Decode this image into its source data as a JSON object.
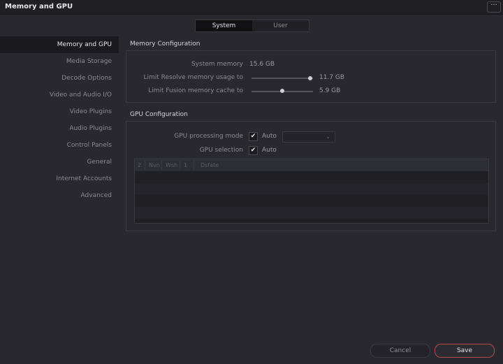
{
  "window": {
    "title": "Memory and GPU",
    "more_label": "···"
  },
  "tabs": [
    {
      "label": "System",
      "active": true
    },
    {
      "label": "User",
      "active": false
    }
  ],
  "sidebar": {
    "items": [
      {
        "label": "Memory and GPU",
        "active": true
      },
      {
        "label": "Media Storage"
      },
      {
        "label": "Decode Options"
      },
      {
        "label": "Video and Audio I/O"
      },
      {
        "label": "Video Plugins"
      },
      {
        "label": "Audio Plugins"
      },
      {
        "label": "Control Panels"
      },
      {
        "label": "General"
      },
      {
        "label": "Internet Accounts"
      },
      {
        "label": "Advanced"
      }
    ]
  },
  "memory": {
    "section_title": "Memory Configuration",
    "system_memory_label": "System memory",
    "system_memory_value": "15.6 GB",
    "resolve_limit_label": "Limit Resolve memory usage to",
    "resolve_limit_value": "11.7 GB",
    "resolve_limit_fraction": 0.95,
    "fusion_limit_label": "Limit Fusion memory cache to",
    "fusion_limit_value": "5.9 GB",
    "fusion_limit_fraction": 0.5
  },
  "gpu": {
    "section_title": "GPU Configuration",
    "processing_mode_label": "GPU processing mode",
    "processing_mode_checked": true,
    "processing_mode_auto": "Auto",
    "selection_label": "GPU selection",
    "selection_checked": true,
    "selection_auto": "Auto",
    "table_headers": [
      "2",
      "Nvn",
      "Wsh",
      "1",
      "Dsfate"
    ]
  },
  "footer": {
    "cancel_label": "Cancel",
    "save_label": "Save"
  },
  "colors": {
    "accent_save_border": "#b94a4a",
    "background": "#28282e"
  }
}
